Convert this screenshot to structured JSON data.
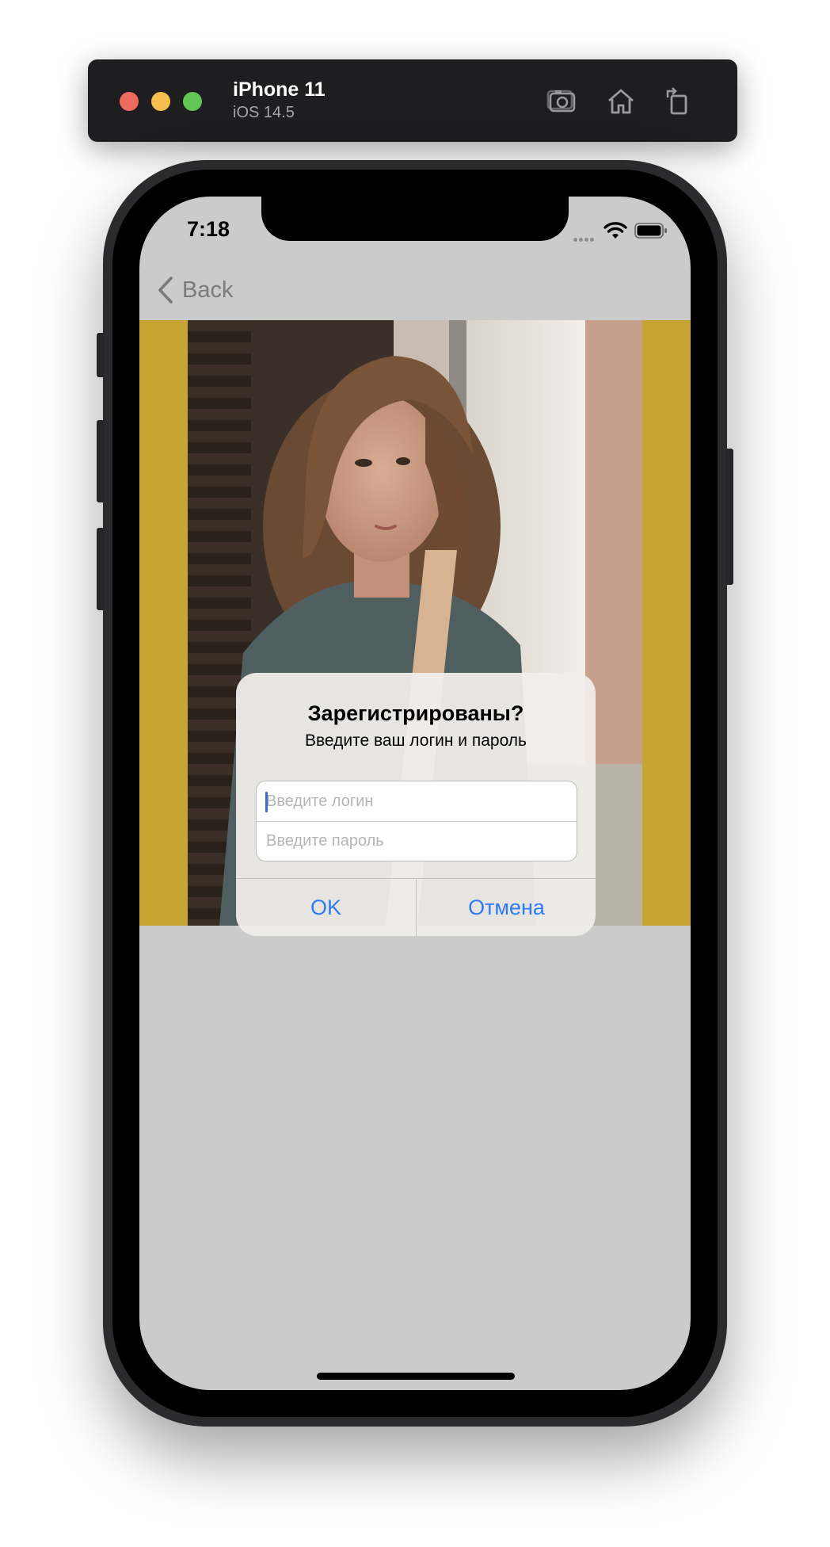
{
  "simulator": {
    "device_name": "iPhone 11",
    "os_version": "iOS 14.5",
    "toolbar_icons": [
      "screenshot-icon",
      "home-icon",
      "rotate-icon"
    ]
  },
  "status_bar": {
    "time": "7:18"
  },
  "nav": {
    "back_label": "Back"
  },
  "photo": {
    "background_color": "#c6a533"
  },
  "alert": {
    "title": "Зарегистрированы?",
    "message": "Введите ваш логин и пароль",
    "login_placeholder": "Введите логин",
    "password_placeholder": "Введите пароль",
    "ok_label": "OK",
    "cancel_label": "Отмена",
    "accent_color": "#2f7bf6"
  }
}
